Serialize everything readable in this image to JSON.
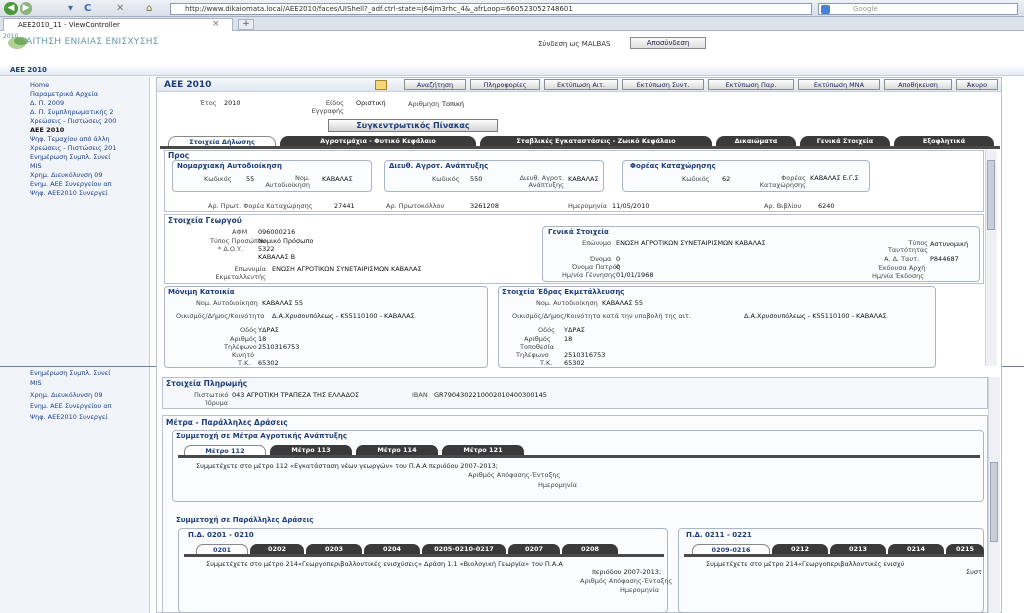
{
  "browser": {
    "url": "http://www.dikaiomata.local/AEE2010/faces/UIShell?_adf.ctrl-state=j64jm3rhc_4&_afrLoop=660523052748601",
    "search_placeholder": "Google",
    "tab_title": "AEE2010_11 - ViewController",
    "new_tab": "+",
    "back": "◀",
    "forward": "▶",
    "reload": "C",
    "stop": "✕",
    "home": "⌂"
  },
  "app": {
    "logo_year": "2010",
    "title": "ΑΙΤΗΣΗ ΕΝΙΑΙΑΣ ΕΝΙΣΧΥΣΗΣ",
    "logged_in": "Σύνδεση ως MALBAS",
    "logout": "Αποσύνδεση",
    "breadcrumb": "ΑΕΕ 2010"
  },
  "sidebar": {
    "items": [
      {
        "label": "Home"
      },
      {
        "label": "Παραμετρικά Αρχεία"
      },
      {
        "label": "Δ. Π. 2009"
      },
      {
        "label": "Δ. Π. Συμπληρωματικής 2"
      },
      {
        "label": "Χρεώσεις - Πιστώσεις 200"
      },
      {
        "label": "ΑΕΕ 2010"
      },
      {
        "label": "Ψηφ. Τεμαχίου από άλλη"
      },
      {
        "label": "Χρεώσεις - Πιστώσεις 201"
      },
      {
        "label": "Ενημέρωση Συμπλ. Συνεί"
      },
      {
        "label": "MIS"
      },
      {
        "label": "Χρημ. Διευκόλυνση 09"
      },
      {
        "label": "Ενημ. ΑΕΕ Συνεργείου απ"
      },
      {
        "label": "Ψηφ. ΑΕΕ2010 Συνεργεί"
      }
    ],
    "items_lower": [
      {
        "label": "Ενημέρωση Συμπλ. Συνεί"
      },
      {
        "label": "MIS"
      },
      {
        "label": "Χρημ. Διευκόλυνση 09"
      },
      {
        "label": "Ενημ. ΑΕΕ Συνεργείου απ"
      },
      {
        "label": "Ψηφ. ΑΕΕ2010 Συνεργεί"
      }
    ]
  },
  "main": {
    "title": "ΑΕΕ 2010",
    "toolbar": [
      "Αναζήτηση",
      "Πληροφορίες",
      "Εκτύπωση Αιτ.",
      "Εκτύπωση Συντ.",
      "Εκτύπωση Παρ.",
      "Εκτύπωση ΜΝΑ",
      "Αποθήκευση",
      "Άκυρο"
    ],
    "header": {
      "year_label": "Έτος",
      "year": "2010",
      "type_label": "Είδος Εγγραφής",
      "type": "Οριστική",
      "number_label": "Αριθμηση",
      "number": "Τοπική"
    },
    "summary_button": "Συγκεντρωτικός Πίνακας",
    "tabs": [
      "Στοιχεία Δήλωσης",
      "Αγροτεμάχια - Φυτικό Κεφάλαιο",
      "Σταβλικές Εγκαταστάσεις - Ζωικό Κεφάλαιο",
      "Δικαιώματα",
      "Γενικά Στοιχεία",
      "Εξοφλητικά"
    ],
    "pros": {
      "title": "Προς",
      "nomarchy": {
        "title": "Νομαρχιακή Αυτοδιοίκηση",
        "code_label": "Κωδικός",
        "code": "55",
        "name_label": "Νομ. Αυτοδιοίκηση",
        "name": "ΚΑΒΑΛΑΣ"
      },
      "agro": {
        "title": "Διευθ. Αγροτ. Ανάπτυξης",
        "code_label": "Κωδικός",
        "code": "550",
        "name_label": "Διευθ. Αγροτ. Ανάπτυξης",
        "name": "ΚΑΒΑΛΑΣ"
      },
      "agency": {
        "title": "Φορέας Καταχώρησης",
        "code_label": "Κωδικός",
        "code": "62",
        "name_label": "Φορέας Καταχώρησης",
        "name": "ΚΑΒΑΛΑΣ Ε.Γ.Σ"
      },
      "reg_label": "Αρ. Πρωτ. Φορέα Καταχώρησης",
      "reg": "27441",
      "proto_label": "Αρ. Πρωτοκόλλου",
      "proto": "3261208",
      "date_label": "Ημερομηνία",
      "date": "11/05/2010",
      "book_label": "Αρ. Βιβλίου",
      "book": "6240"
    },
    "farmer": {
      "title": "Στοιχεία Γεωργού",
      "afm_label": "ΑΦΜ",
      "afm": "096000216",
      "type_label": "Τύπος Προσώπου",
      "type": "Νομικό Πρόσωπο",
      "doy_label": "* Δ.Ο.Υ.",
      "doy_code": "5322",
      "doy": "ΚΑΒΑΛΑΣ Β",
      "name_label": "Επωνυμία Εκμεταλλευτής",
      "name": "ΕΝΩΣΗ ΑΓΡΟΤΙΚΩΝ ΣΥΝΕΤΑΙΡΙΣΜΩΝ ΚΑΒΑΛΑΣ",
      "general": {
        "title": "Γενικά Στοιχεία",
        "surname_label": "Επώνυμο",
        "surname": "ΕΝΩΣΗ ΑΓΡΟΤΙΚΩΝ ΣΥΝΕΤΑΙΡΙΣΜΩΝ ΚΑΒΑΛΑΣ",
        "first_label": "Όνομα",
        "first": "0",
        "father_label": "Όνομα Πατρός",
        "father": "0",
        "birth_label": "Ημ/νία Γέννησης",
        "birth": "01/01/1968",
        "id_type_label": "Τύπος Ταυτότητας",
        "id_type": "Αστυνομική",
        "id_label": "Α. Δ. Ταυτ.",
        "id": "Ρ844687",
        "issuer_label": "Έκδουσα Αρχή",
        "issue_date_label": "Ημ/νία Έκδοσης"
      }
    },
    "residence": {
      "title": "Μόνιμη Κατοικία",
      "nom_label": "Νομ. Αυτοδιοίκηση",
      "nom": "ΚΑΒΑΛΑΣ 55",
      "area_label": "Οικισμός/Δήμος/Κοινότητα",
      "area": "Δ.Α.Χρυσουπόλεως - Κ55110100 - ΚΑΒΑΛΑΣ",
      "street_label": "Οδός",
      "street": "ΥΔΡΑΣ",
      "num_label": "Αριθμός",
      "num": "18",
      "phone_label": "Τηλέφωνο",
      "phone": "2510316753",
      "mobile_label": "Κινητό",
      "zip_label": "Τ.Κ.",
      "zip": "65302"
    },
    "seat": {
      "title": "Στοιχεία Έδρας Εκμετάλλευσης",
      "nom_label": "Νομ. Αυτοδιοίκηση",
      "nom": "ΚΑΒΑΛΑΣ 55",
      "area_label": "Οικισμός/Δήμος/Κοινότητα κατά την υποβολή της αιτ.",
      "area": "Δ.Α.Χρυσουπόλεως - Κ55110100 - ΚΑΒΑΛΑΣ",
      "street_label": "Οδός",
      "street": "ΥΔΡΑΣ",
      "num_label": "Αριθμός",
      "num": "18",
      "place_label": "Τοποθεσία",
      "phone_label": "Τηλέφωνο",
      "phone": "2510316753",
      "zip_label": "Τ.Κ.",
      "zip": "65302"
    },
    "payment": {
      "title": "Στοιχεία Πληρωμής",
      "bank_label": "Πιστωτικό Ίδρυμα",
      "bank": "043 ΑΓΡΟΤΙΚΗ ΤΡΑΠΕΖΑ ΤΗΣ ΕΛΛΑΔΟΣ",
      "iban_label": "IBAN",
      "iban": "GR7904302210002010400300145"
    },
    "measures": {
      "title": "Μέτρα - Παράλληλες Δράσεις",
      "agro_dev_title": "Συμμετοχή σε Μέτρα Αγροτικής Ανάπτυξης",
      "measure_tabs": [
        "Μέτρο 112",
        "Μέτρο 113",
        "Μέτρο 114",
        "Μέτρο 121"
      ],
      "measure_text": "Συμμετέχετε στο μέτρο 112 «Εγκατάσταση νέων γεωργών» του Π.Α.Α περιόδου 2007-2013;",
      "decision_label": "Αριθμός Απόφασης-Ένταξης",
      "date_label": "Ημερομηνία",
      "parallel_title": "Συμμετοχή σε Παράλληλες Δράσεις",
      "pd1_title": "Π.Δ. 0201 - 0210",
      "pd1_tabs": [
        "0201",
        "0202",
        "0203",
        "0204",
        "0205-0210-0217",
        "0207",
        "0208"
      ],
      "pd1_text1": "Συμμετέχετε στο μέτρο 214«Γεωργοπεριβαλλοντικές ενισχύσεις» Δράση 1.1 «Βιολογική Γεωργία» του Π.Α.Α",
      "pd1_text2": "περιόδου 2007-2013;",
      "pd1_decision": "Αριθμός Απόφασης-Ένταξης",
      "pd1_date": "Ημερομηνία",
      "pd2_title": "Π.Δ. 0211 - 0221",
      "pd2_tabs": [
        "0209-0216",
        "0212",
        "0213",
        "0214",
        "0215"
      ],
      "pd2_text1": "Συμμετέχετε στο μέτρο 214«Γεωργοπεριβαλλοντικές ενισχύ",
      "pd2_text2": "Συστ"
    }
  }
}
